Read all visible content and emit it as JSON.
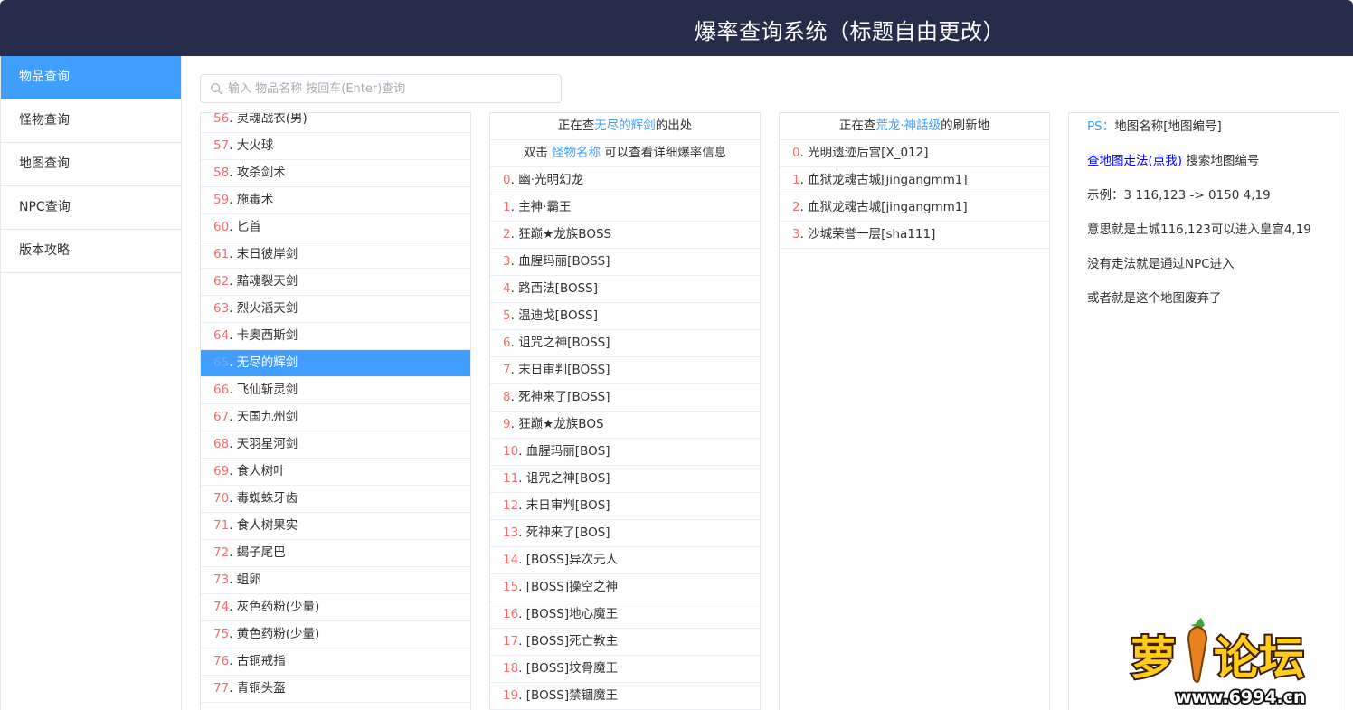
{
  "header": {
    "title": "爆率查询系统（标题自由更改）"
  },
  "sidebar": {
    "items": [
      {
        "label": "物品查询",
        "active": true
      },
      {
        "label": "怪物查询"
      },
      {
        "label": "地图查询"
      },
      {
        "label": "NPC查询"
      },
      {
        "label": "版本攻略"
      }
    ]
  },
  "search": {
    "placeholder": "输入 物品名称 按回车(Enter)查询",
    "value": ""
  },
  "items": {
    "selected_index": 9,
    "rows": [
      {
        "num": "56",
        "name": "灵魂战衣(男)"
      },
      {
        "num": "57",
        "name": "大火球"
      },
      {
        "num": "58",
        "name": "攻杀剑术"
      },
      {
        "num": "59",
        "name": "施毒术"
      },
      {
        "num": "60",
        "name": "匕首"
      },
      {
        "num": "61",
        "name": "末日彼岸剑"
      },
      {
        "num": "62",
        "name": "黯魂裂天剑"
      },
      {
        "num": "63",
        "name": "烈火滔天剑"
      },
      {
        "num": "64",
        "name": "卡奥西斯剑"
      },
      {
        "num": "65",
        "name": "无尽的辉剑"
      },
      {
        "num": "66",
        "name": "飞仙斩灵剑"
      },
      {
        "num": "67",
        "name": "天国九州剑"
      },
      {
        "num": "68",
        "name": "天羽星河剑"
      },
      {
        "num": "69",
        "name": "食人树叶"
      },
      {
        "num": "70",
        "name": "毒蜘蛛牙齿"
      },
      {
        "num": "71",
        "name": "食人树果实"
      },
      {
        "num": "72",
        "name": "蝎子尾巴"
      },
      {
        "num": "73",
        "name": "蛆卵"
      },
      {
        "num": "74",
        "name": "灰色药粉(少量)"
      },
      {
        "num": "75",
        "name": "黄色药粉(少量)"
      },
      {
        "num": "76",
        "name": "古铜戒指"
      },
      {
        "num": "77",
        "name": "青铜头盔"
      }
    ]
  },
  "monsters": {
    "header_prefix": "正在查",
    "header_item": "无尽的辉剑",
    "header_suffix": "的出处",
    "hint_prefix": "双击",
    "hint_link": "怪物名称",
    "hint_suffix": "可以查看详细爆率信息",
    "rows": [
      {
        "num": "0",
        "name": "幽·光明幻龙"
      },
      {
        "num": "1",
        "name": "主神·霸王"
      },
      {
        "num": "2",
        "name": "狂巅★龙族BOSS"
      },
      {
        "num": "3",
        "name": "血腥玛丽[BOSS]"
      },
      {
        "num": "4",
        "name": "路西法[BOSS]"
      },
      {
        "num": "5",
        "name": "温迪戈[BOSS]"
      },
      {
        "num": "6",
        "name": "诅咒之神[BOSS]"
      },
      {
        "num": "7",
        "name": "末日审判[BOSS]"
      },
      {
        "num": "8",
        "name": "死神来了[BOSS]"
      },
      {
        "num": "9",
        "name": "狂巅★龙族BOS"
      },
      {
        "num": "10",
        "name": "血腥玛丽[BOS]"
      },
      {
        "num": "11",
        "name": "诅咒之神[BOS]"
      },
      {
        "num": "12",
        "name": "末日审判[BOS]"
      },
      {
        "num": "13",
        "name": "死神来了[BOS]"
      },
      {
        "num": "14",
        "name": "[BOSS]异次元人"
      },
      {
        "num": "15",
        "name": "[BOSS]操空之神"
      },
      {
        "num": "16",
        "name": "[BOSS]地心魔王"
      },
      {
        "num": "17",
        "name": "[BOSS]死亡教主"
      },
      {
        "num": "18",
        "name": "[BOSS]坟骨魔王"
      },
      {
        "num": "19",
        "name": "[BOSS]禁锢魔王"
      }
    ]
  },
  "maps": {
    "header_prefix": "正在查",
    "header_item": "荒龙·神話级",
    "header_suffix": "的刷新地",
    "rows": [
      {
        "num": "0",
        "name": "光明遗迹后宫[X_012]"
      },
      {
        "num": "1",
        "name": "血狱龙魂古城[jingangmm1]"
      },
      {
        "num": "2",
        "name": "血狱龙魂古城[jingangmm1]"
      },
      {
        "num": "3",
        "name": "沙城荣誉一层[sha111]"
      }
    ]
  },
  "info": {
    "ps_label": "PS：",
    "ps_text": "地图名称[地图编号]",
    "link_text": "查地图走法(点我)",
    "link_suffix": "搜索地图编号",
    "example": "示例：3 116,123 -> 0150 4,19",
    "meaning": "意思就是土城116,123可以进入皇宫4,19",
    "no_path": "没有走法就是通过NPC进入",
    "abandoned": "或者就是这个地图废弃了"
  },
  "watermark": {
    "text": "萝卜论坛",
    "url": "www.6994.cn"
  },
  "colors": {
    "header_bg": "#262d4a",
    "accent": "#409eff",
    "index_red": "#f56c6c"
  }
}
